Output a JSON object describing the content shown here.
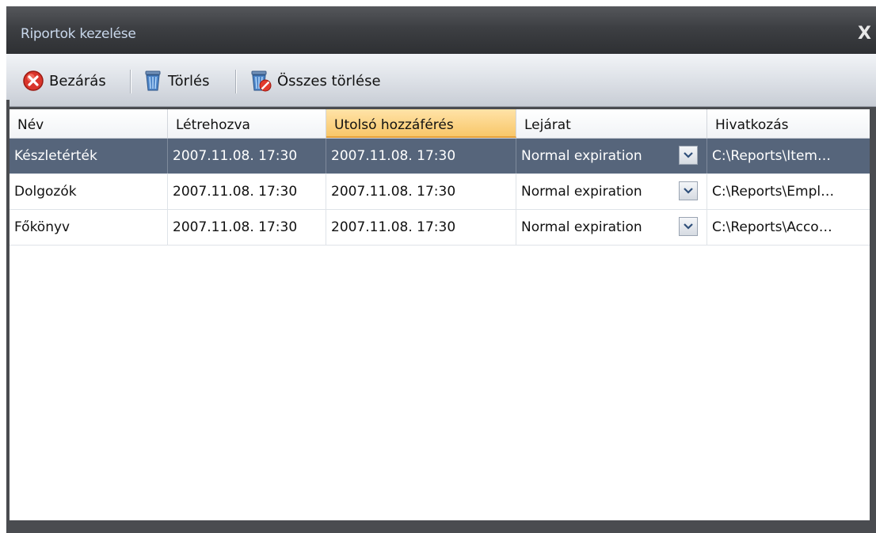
{
  "window": {
    "title": "Riportok kezelése",
    "close_glyph": "X"
  },
  "toolbar": {
    "close_label": "Bezárás",
    "delete_label": "Törlés",
    "delete_all_label": "Összes törlése",
    "icons": {
      "close": "red-close-circle-icon",
      "delete": "trash-bin-icon",
      "delete_all": "trash-bin-forbidden-icon"
    }
  },
  "grid": {
    "columns": [
      "Név",
      "Létrehozva",
      "Utolsó hozzáférés",
      "Lejárat",
      "Hivatkozás"
    ],
    "sorted_column": "Utolsó hozzáférés",
    "rows": [
      {
        "name": "Készletérték",
        "created": "2007.11.08. 17:30",
        "last_access": "2007.11.08. 17:30",
        "expiration": "Normal expiration",
        "link": "C:\\Reports\\Item…",
        "selected": true
      },
      {
        "name": "Dolgozók",
        "created": "2007.11.08. 17:30",
        "last_access": "2007.11.08. 17:30",
        "expiration": "Normal expiration",
        "link": "C:\\Reports\\Empl…",
        "selected": false
      },
      {
        "name": "Főkönyv",
        "created": "2007.11.08. 17:30",
        "last_access": "2007.11.08. 17:30",
        "expiration": "Normal expiration",
        "link": "C:\\Reports\\Acco…",
        "selected": false
      }
    ]
  },
  "colors": {
    "selected_row": "#56657b",
    "sorted_header": "#f8c76a",
    "title_text": "#c9d8ec"
  }
}
